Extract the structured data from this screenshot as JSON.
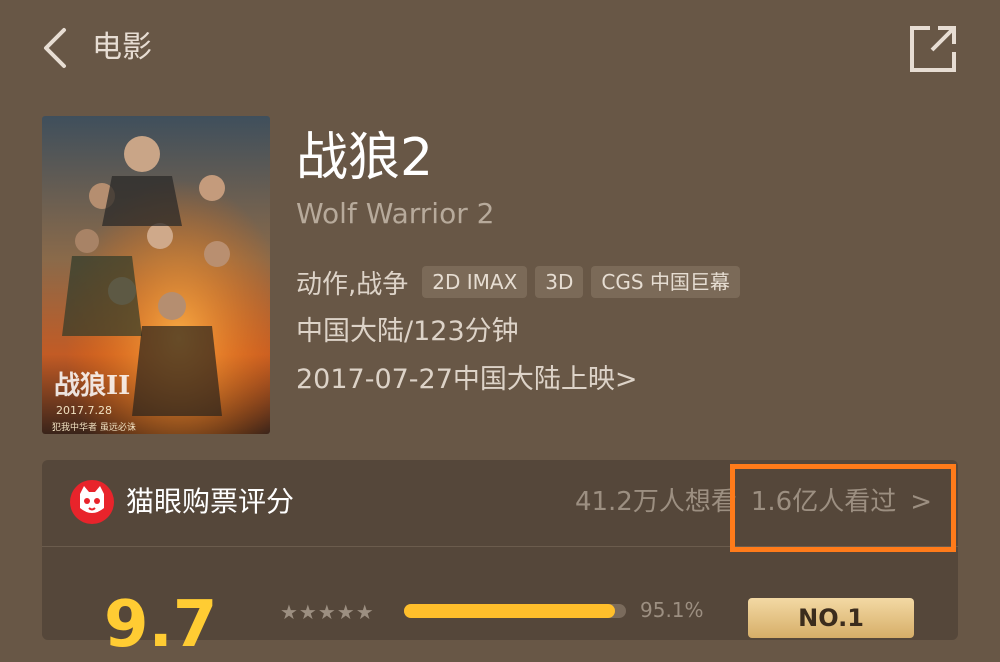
{
  "nav": {
    "title": "电影"
  },
  "movie": {
    "title": "战狼2",
    "title_en": "Wolf Warrior 2",
    "genre": "动作,战争",
    "tags": [
      "2D IMAX",
      "3D",
      "CGS 中国巨幕"
    ],
    "region_duration": "中国大陆/123分钟",
    "release": "2017-07-27中国大陆上映",
    "release_chevron": ">"
  },
  "rating": {
    "source": "猫眼购票评分",
    "want_to_see": "41.2万人想看",
    "watched": "1.6亿人看过",
    "watched_chevron": ">",
    "score": "9.7",
    "stars": "★★★★★",
    "five_star_percent_text": "95.1%",
    "five_star_fraction": 0.951,
    "rank": "NO.1"
  },
  "colors": {
    "background": "#685746",
    "highlight_border": "#ff7b1a",
    "score": "#ffcc33"
  },
  "icons": {
    "back": "chevron-left-icon",
    "share": "share-icon",
    "maoyan": "maoyan-cat-logo"
  }
}
